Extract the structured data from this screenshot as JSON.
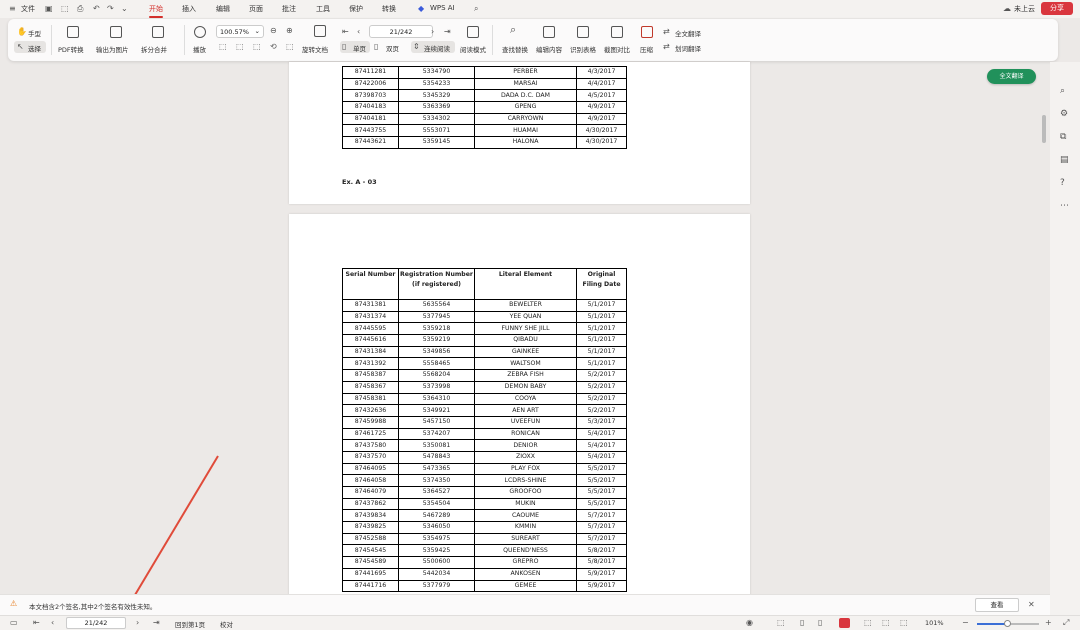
{
  "menubar": {
    "file": "文件",
    "tabs": [
      "开始",
      "插入",
      "编辑",
      "页面",
      "批注",
      "工具",
      "保护",
      "转换"
    ],
    "wps_ai": "WPS AI",
    "cloud": "未上云",
    "share": "分享"
  },
  "toolbar": {
    "hand": "手型",
    "select": "选择",
    "pdf_convert": "PDF转换",
    "export_image": "输出为图片",
    "split_merge": "拆分合并",
    "play": "播放",
    "zoom": "100.57%",
    "rotate_doc": "旋转文档",
    "single": "单页",
    "double": "双页",
    "continuous": "连续阅读",
    "read_mode": "阅读模式",
    "page": "21/242",
    "find_replace": "查找替换",
    "edit_content": "编辑内容",
    "recognize_table": "识别表格",
    "screenshot_compare": "截图对比",
    "compress": "压缩",
    "full_translate": "全文翻译",
    "word_translate": "划词翻译"
  },
  "green_button": "全文翻译",
  "page1": {
    "rows": [
      [
        "87411281",
        "5334790",
        "PERBER",
        "4/3/2017"
      ],
      [
        "87422006",
        "5354233",
        "MARSAI",
        "4/4/2017"
      ],
      [
        "87398703",
        "5345329",
        "DADA D.C. DAM",
        "4/5/2017"
      ],
      [
        "87404183",
        "5363369",
        "GPENG",
        "4/9/2017"
      ],
      [
        "87404181",
        "5334302",
        "CARRYOWN",
        "4/9/2017"
      ],
      [
        "87443755",
        "5553071",
        "HUAMAI",
        "4/30/2017"
      ],
      [
        "87443621",
        "5359145",
        "HALONA",
        "4/30/2017"
      ]
    ],
    "exhibit": "Ex. A - 03"
  },
  "page2": {
    "headers": [
      "Serial Number",
      "Registration Number (if registered)",
      "Literal Element",
      "Original Filing Date"
    ],
    "rows": [
      [
        "87431381",
        "5635564",
        "BEWELTER",
        "5/1/2017"
      ],
      [
        "87431374",
        "5377945",
        "YEE QUAN",
        "5/1/2017"
      ],
      [
        "87445595",
        "5359218",
        "FUNNY SHE JILL",
        "5/1/2017"
      ],
      [
        "87445616",
        "5359219",
        "QIBADU",
        "5/1/2017"
      ],
      [
        "87431384",
        "5349856",
        "GAINKEE",
        "5/1/2017"
      ],
      [
        "87431392",
        "5558465",
        "WALTSOM",
        "5/1/2017"
      ],
      [
        "87458387",
        "5568204",
        "ZEBRA FISH",
        "5/2/2017"
      ],
      [
        "87458367",
        "5373998",
        "DEMON BABY",
        "5/2/2017"
      ],
      [
        "87458381",
        "5364310",
        "COOYA",
        "5/2/2017"
      ],
      [
        "87432636",
        "5349921",
        "AEN ART",
        "5/2/2017"
      ],
      [
        "87459988",
        "5457150",
        "UVEEFUN",
        "5/3/2017"
      ],
      [
        "87461725",
        "5374207",
        "RONICAN",
        "5/4/2017"
      ],
      [
        "87437580",
        "5350081",
        "DENIOR",
        "5/4/2017"
      ],
      [
        "87437570",
        "5478843",
        "ZIOXX",
        "5/4/2017"
      ],
      [
        "87464095",
        "5473365",
        "PLAY FOX",
        "5/5/2017"
      ],
      [
        "87464058",
        "5374350",
        "LCDRS-SHINE",
        "5/5/2017"
      ],
      [
        "87464079",
        "5364527",
        "GROOFOO",
        "5/5/2017"
      ],
      [
        "87437862",
        "5354504",
        "MUKIN",
        "5/5/2017"
      ],
      [
        "87439834",
        "5467289",
        "CAOUME",
        "5/7/2017"
      ],
      [
        "87439825",
        "5346050",
        "KMMIN",
        "5/7/2017"
      ],
      [
        "87452588",
        "5354975",
        "SUREART",
        "5/7/2017"
      ],
      [
        "87454545",
        "5359425",
        "QUEEND'NESS",
        "5/8/2017"
      ],
      [
        "87454589",
        "5500600",
        "GREPRO",
        "5/8/2017"
      ],
      [
        "87441695",
        "5442034",
        "ANKOSEN",
        "5/9/2017"
      ],
      [
        "87441716",
        "5377979",
        "GEMEE",
        "5/9/2017"
      ]
    ]
  },
  "notice": {
    "text": "本文档含2个签名,其中2个签名有效性未知。",
    "view": "查看"
  },
  "status": {
    "page": "21/242",
    "back": "回到第1页",
    "proof": "校对",
    "zoom": "101%"
  }
}
